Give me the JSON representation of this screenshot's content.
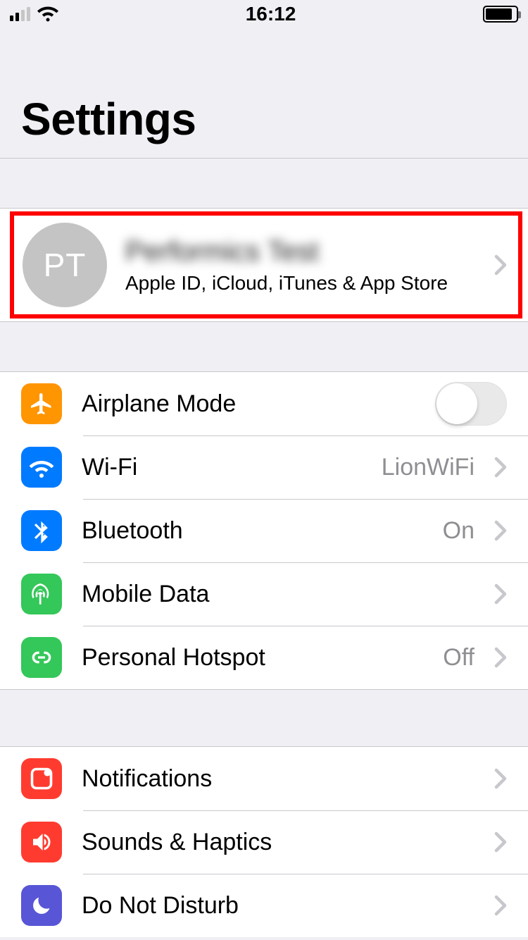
{
  "status_bar": {
    "time": "16:12"
  },
  "header": {
    "title": "Settings"
  },
  "account": {
    "avatar_initials": "PT",
    "name": "Performics Test",
    "subtitle": "Apple ID, iCloud, iTunes & App Store"
  },
  "network_group": {
    "airplane": {
      "label": "Airplane Mode",
      "on": false
    },
    "wifi": {
      "label": "Wi-Fi",
      "detail": "LionWiFi"
    },
    "bluetooth": {
      "label": "Bluetooth",
      "detail": "On"
    },
    "mobile_data": {
      "label": "Mobile Data"
    },
    "hotspot": {
      "label": "Personal Hotspot",
      "detail": "Off"
    }
  },
  "prefs_group": {
    "notifications": {
      "label": "Notifications"
    },
    "sounds": {
      "label": "Sounds & Haptics"
    },
    "dnd": {
      "label": "Do Not Disturb"
    }
  }
}
